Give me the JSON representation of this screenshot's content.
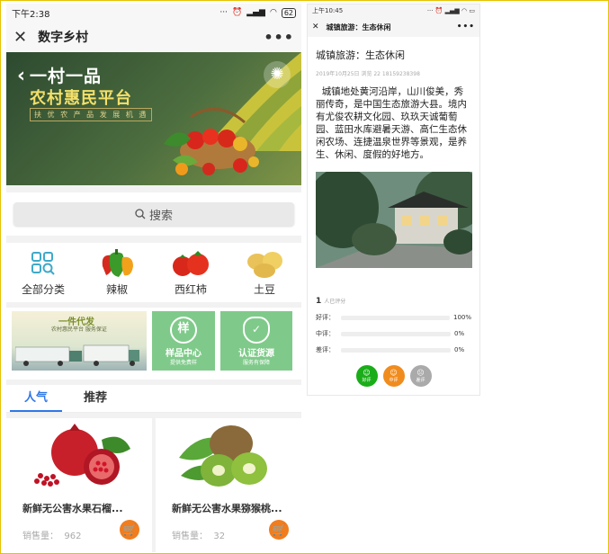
{
  "left": {
    "status": {
      "time": "下午2:38",
      "battery": "62"
    },
    "nav": {
      "title": "数字乡村"
    },
    "banner": {
      "line1": "一村一品",
      "line2": "农村惠民平台",
      "line3": "扶 优 农 产 品 发 展 机 遇"
    },
    "search": {
      "label": "搜索"
    },
    "categories": [
      {
        "label": "全部分类",
        "icon": "grid-search-icon"
      },
      {
        "label": "辣椒",
        "icon": "pepper-image"
      },
      {
        "label": "西红柿",
        "icon": "tomato-image"
      },
      {
        "label": "土豆",
        "icon": "potato-image"
      }
    ],
    "promos": {
      "p1_title": "一件代发",
      "p1_sub": "农村惠民平台  服务保证",
      "p2_icon": "样",
      "p2_title": "样品中心",
      "p2_sub": "提供免费样",
      "p3_title": "认证货源",
      "p3_sub": "服务有保障"
    },
    "tabs": [
      {
        "label": "人气",
        "active": true
      },
      {
        "label": "推荐",
        "active": false
      }
    ],
    "products": [
      {
        "name": "新鲜无公害水果石榴...",
        "sold_label": "销售量：",
        "sold": "962"
      },
      {
        "name": "新鲜无公害水果猕猴桃...",
        "sold_label": "销售量：",
        "sold": "32"
      }
    ]
  },
  "right": {
    "status": {
      "time": "上午10:45"
    },
    "nav": {
      "title": "城镇旅游：生态休闲"
    },
    "article": {
      "title": "城镇旅游：生态休闲",
      "meta": "2019年10月25日  浏览 22  18159238398",
      "body": "城镇地处黄河沿岸，山川俊美，秀丽传奇，是中国生态旅游大县。境内有尤俊农耕文化园、玖玖天诚葡萄园、蓝田水库避暑天游、高仁生态休闲农场、连捷温泉世界等景观，是养生、休闲、度假的好地方。"
    },
    "rating": {
      "count": "1",
      "count_label": "人已评分",
      "rows": [
        {
          "label": "好评：",
          "pct": "100%",
          "fraction": 1.0
        },
        {
          "label": "中评：",
          "pct": "0%",
          "fraction": 0
        },
        {
          "label": "差评：",
          "pct": "0%",
          "fraction": 0
        }
      ],
      "buttons": [
        {
          "label": "好评",
          "color": "#1aad19"
        },
        {
          "label": "中评",
          "color": "#f08c1e"
        },
        {
          "label": "差评",
          "color": "#aaaaaa"
        }
      ]
    }
  }
}
